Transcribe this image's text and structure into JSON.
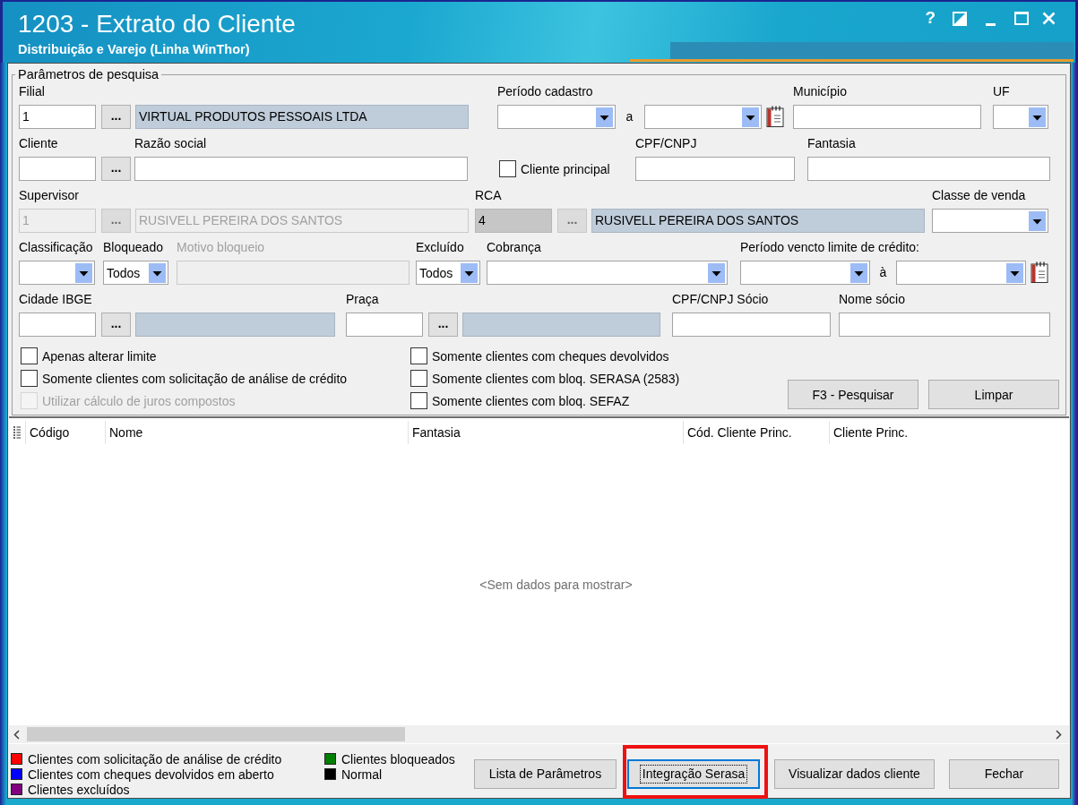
{
  "window": {
    "title": "1203 - Extrato do Cliente",
    "subtitle": "Distribuição e Varejo (Linha WinThor)",
    "help_button": "?"
  },
  "search_params": {
    "title": "Parâmetros de pesquisa",
    "filial": {
      "label": "Filial",
      "code": "1",
      "button": "...",
      "description": "VIRTUAL PRODUTOS PESSOAIS LTDA",
      "disabled": false,
      "read_only": false
    },
    "periodo_cadastro": {
      "label": "Período cadastro",
      "separator": "a"
    },
    "municipio": {
      "label": "Município"
    },
    "uf": {
      "label": "UF"
    },
    "cliente": {
      "label": "Cliente",
      "button": "...",
      "disabled": false,
      "read_only": false
    },
    "razao_social": {
      "label": "Razão social"
    },
    "cliente_principal": {
      "label": "Cliente principal",
      "checked": false
    },
    "cpf_cnpj": {
      "label": "CPF/CNPJ"
    },
    "fantasia": {
      "label": "Fantasia"
    },
    "supervisor": {
      "label": "Supervisor",
      "code": "1",
      "button": "...",
      "description": "RUSIVELL PEREIRA DOS SANTOS",
      "disabled": true,
      "read_only": false
    },
    "rca": {
      "label": "RCA",
      "code": "4",
      "button": "...",
      "description": "RUSIVELL PEREIRA DOS SANTOS",
      "disabled": false,
      "read_only": true
    },
    "classe_venda": {
      "label": "Classe de venda"
    },
    "classificacao": {
      "label": "Classificação"
    },
    "bloqueado": {
      "label": "Bloqueado",
      "value": "Todos"
    },
    "motivo_bloqueio": {
      "label": "Motivo bloqueio",
      "disabled": true
    },
    "excluido": {
      "label": "Excluído",
      "value": "Todos"
    },
    "cobranca": {
      "label": "Cobrança"
    },
    "periodo_vencto": {
      "label": "Período vencto limite de crédito:",
      "separator": "à"
    },
    "cidade_ibge": {
      "label": "Cidade IBGE",
      "button": "...",
      "disabled": false,
      "read_only": false
    },
    "praca": {
      "label": "Praça",
      "button": "...",
      "disabled": false,
      "read_only": false
    },
    "cpf_cnpj_socio": {
      "label": "CPF/CNPJ Sócio"
    },
    "nome_socio": {
      "label": "Nome sócio"
    },
    "option_columns": [
      [
        {
          "label": "Apenas alterar limite",
          "checked": false,
          "disabled": false
        },
        {
          "label": "Somente clientes com solicitação de análise de crédito",
          "checked": false,
          "disabled": false
        },
        {
          "label": "Utilizar cálculo de juros compostos",
          "checked": false,
          "disabled": true
        }
      ],
      [
        {
          "label": "Somente clientes com cheques devolvidos",
          "checked": false,
          "disabled": false
        },
        {
          "label": "Somente clientes com bloq. SERASA (2583)",
          "checked": false,
          "disabled": false
        },
        {
          "label": "Somente clientes com bloq. SEFAZ",
          "checked": false,
          "disabled": false
        }
      ]
    ],
    "actions": [
      {
        "label": "F3 - Pesquisar"
      },
      {
        "label": "Limpar"
      }
    ]
  },
  "grid": {
    "columns": [
      "Código",
      "Nome",
      "Fantasia",
      "Cód. Cliente Princ.",
      "Cliente Princ."
    ],
    "empty_text": "<Sem dados para mostrar>"
  },
  "legend": [
    [
      {
        "label": "Clientes com solicitação de análise de crédito",
        "color": "#ff0000"
      },
      {
        "label": "Clientes com cheques devolvidos em aberto",
        "color": "#0000ff"
      },
      {
        "label": "Clientes excluídos",
        "color": "#800080"
      }
    ],
    [
      {
        "label": "Clientes bloqueados",
        "color": "#008000"
      },
      {
        "label": "Normal",
        "color": "#000000"
      }
    ]
  ],
  "footer_buttons": [
    {
      "label": "Lista de Parâmetros",
      "focused": false,
      "highlighted": false
    },
    {
      "label": "Integração Serasa",
      "focused": true,
      "highlighted": true
    },
    {
      "label": "Visualizar dados cliente",
      "focused": false,
      "highlighted": false
    },
    {
      "label": "Fechar",
      "focused": false,
      "highlighted": false
    }
  ]
}
